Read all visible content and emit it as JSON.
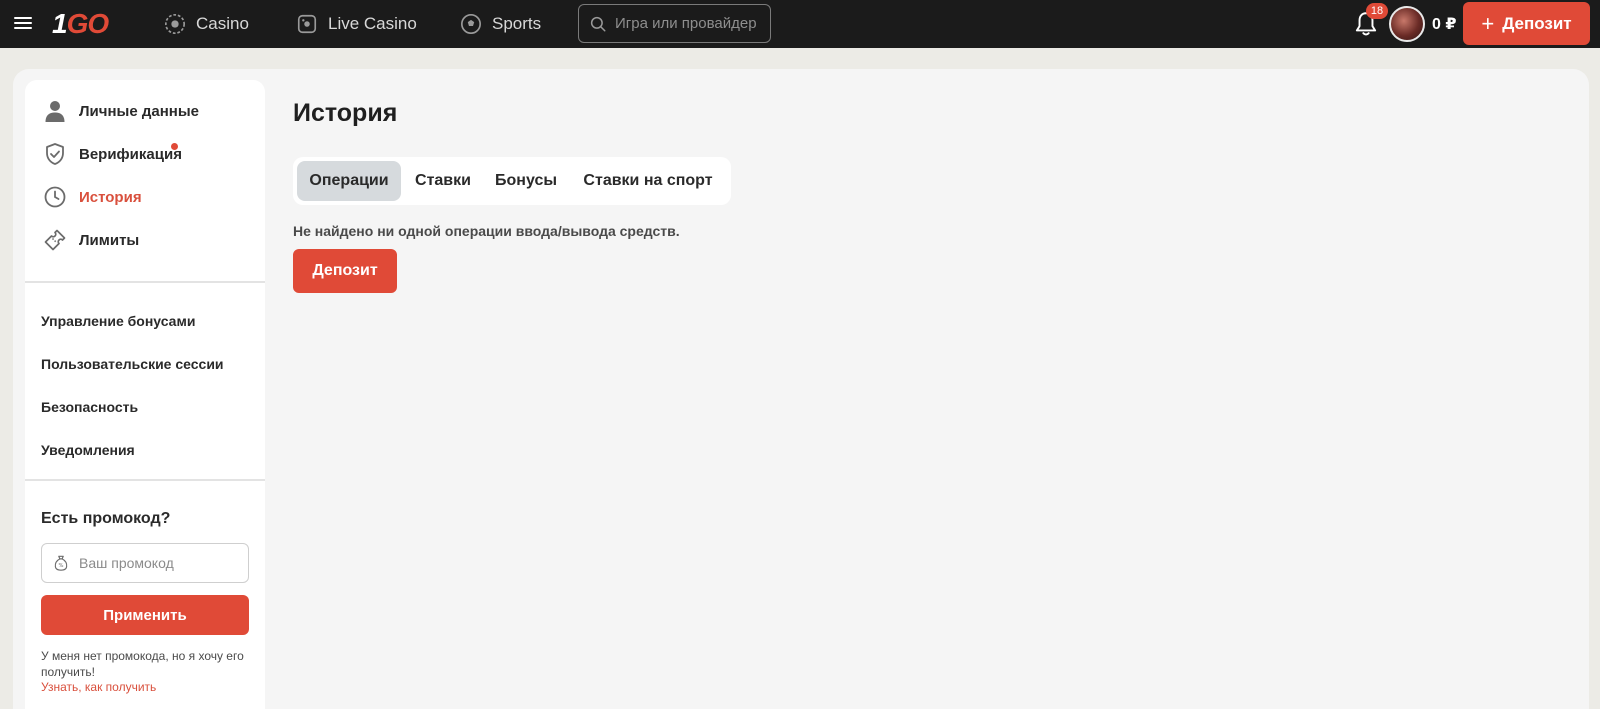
{
  "header": {
    "logo": {
      "part1": "1",
      "part2": "GO"
    },
    "nav": [
      {
        "label": "Casino",
        "icon": "roulette-icon"
      },
      {
        "label": "Live Casino",
        "icon": "live-casino-icon"
      },
      {
        "label": "Sports",
        "icon": "soccer-ball-icon"
      }
    ],
    "search_placeholder": "Игра или провайдер",
    "notifications_count": "18",
    "balance": "0 ₽",
    "deposit_label": "Депозит"
  },
  "sidebar": {
    "items": [
      {
        "label": "Личные данные",
        "icon": "user-icon"
      },
      {
        "label": "Верификация",
        "icon": "shield-check-icon"
      },
      {
        "label": "История",
        "icon": "clock-icon",
        "active": true
      },
      {
        "label": "Лимиты",
        "icon": "ticket-icon"
      }
    ],
    "links": [
      "Управление бонусами",
      "Пользовательские сессии",
      "Безопасность",
      "Уведомления"
    ],
    "promo": {
      "title": "Есть промокод?",
      "placeholder": "Ваш промокод",
      "apply_label": "Применить",
      "hint": "У меня нет промокода, но я хочу его получить!",
      "link": "Узнать, как получить"
    }
  },
  "main": {
    "title": "История",
    "tabs": [
      {
        "label": "Операции",
        "active": true
      },
      {
        "label": "Ставки"
      },
      {
        "label": "Бонусы"
      },
      {
        "label": "Ставки на спорт"
      }
    ],
    "empty_message": "Не найдено ни одной операции ввода/вывода средств.",
    "deposit_label": "Депозит"
  },
  "colors": {
    "accent": "#e04a37",
    "header_bg": "#1b1b1b",
    "page_bg": "#ecebe6",
    "panel_bg": "#f5f5f5",
    "active_tab_bg": "#d6dadd"
  }
}
